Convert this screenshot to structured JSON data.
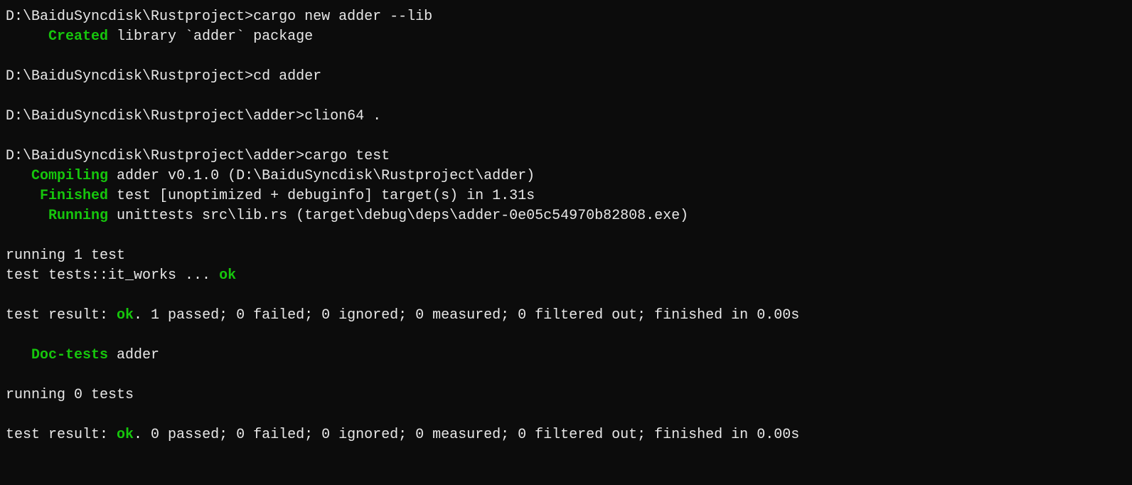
{
  "lines": [
    {
      "type": "prompt",
      "prompt": "D:\\BaiduSyncdisk\\Rustproject>",
      "command": "cargo new adder --lib"
    },
    {
      "type": "status",
      "indent": "     ",
      "status": "Created",
      "rest": " library `adder` package"
    },
    {
      "type": "blank"
    },
    {
      "type": "prompt",
      "prompt": "D:\\BaiduSyncdisk\\Rustproject>",
      "command": "cd adder"
    },
    {
      "type": "blank"
    },
    {
      "type": "prompt",
      "prompt": "D:\\BaiduSyncdisk\\Rustproject\\adder>",
      "command": "clion64 ."
    },
    {
      "type": "blank"
    },
    {
      "type": "prompt",
      "prompt": "D:\\BaiduSyncdisk\\Rustproject\\adder>",
      "command": "cargo test"
    },
    {
      "type": "status",
      "indent": "   ",
      "status": "Compiling",
      "rest": " adder v0.1.0 (D:\\BaiduSyncdisk\\Rustproject\\adder)"
    },
    {
      "type": "status",
      "indent": "    ",
      "status": "Finished",
      "rest": " test [unoptimized + debuginfo] target(s) in 1.31s"
    },
    {
      "type": "status",
      "indent": "     ",
      "status": "Running",
      "rest": " unittests src\\lib.rs (target\\debug\\deps\\adder-0e05c54970b82808.exe)"
    },
    {
      "type": "blank"
    },
    {
      "type": "plain",
      "text": "running 1 test"
    },
    {
      "type": "testline",
      "prefix": "test tests::it_works ... ",
      "result": "ok"
    },
    {
      "type": "blank"
    },
    {
      "type": "result",
      "prefix": "test result: ",
      "status": "ok",
      "rest": ". 1 passed; 0 failed; 0 ignored; 0 measured; 0 filtered out; finished in 0.00s"
    },
    {
      "type": "blank"
    },
    {
      "type": "status",
      "indent": "   ",
      "status": "Doc-tests",
      "rest": " adder"
    },
    {
      "type": "blank"
    },
    {
      "type": "plain",
      "text": "running 0 tests"
    },
    {
      "type": "blank"
    },
    {
      "type": "result",
      "prefix": "test result: ",
      "status": "ok",
      "rest": ". 0 passed; 0 failed; 0 ignored; 0 measured; 0 filtered out; finished in 0.00s"
    }
  ]
}
